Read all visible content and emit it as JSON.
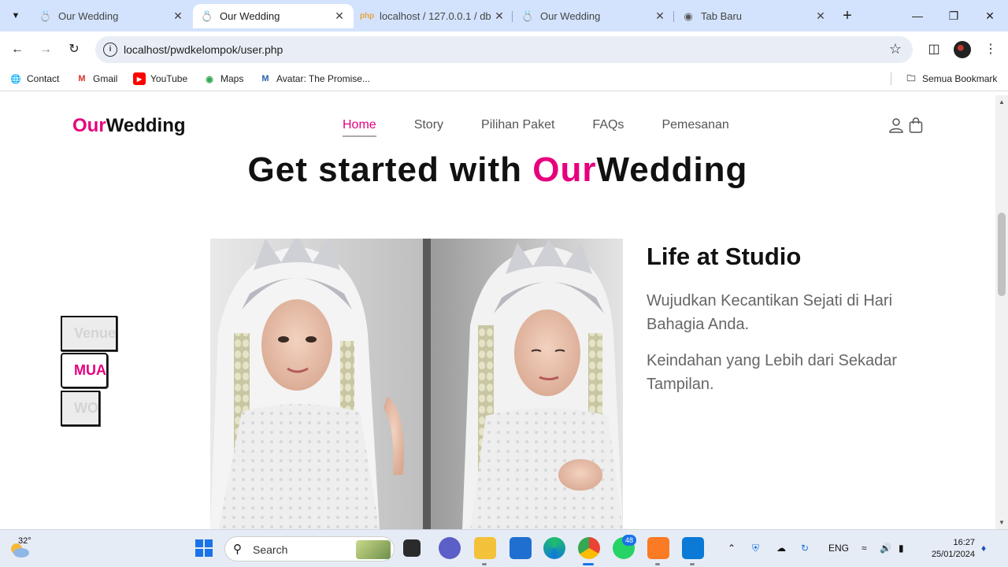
{
  "browser": {
    "tabs": [
      {
        "title": "Our Wedding",
        "active": false
      },
      {
        "title": "Our Wedding",
        "active": true
      },
      {
        "title": "localhost / 127.0.0.1 / db",
        "active": false
      },
      {
        "title": "Our Wedding",
        "active": false
      },
      {
        "title": "Tab Baru",
        "active": false
      }
    ],
    "url": "localhost/pwdkelompok/user.php",
    "bookmarks": [
      "Contact",
      "Gmail",
      "YouTube",
      "Maps",
      "Avatar: The Promise..."
    ],
    "all_bookmarks": "Semua Bookmark"
  },
  "site": {
    "logo_accent": "Our",
    "logo_rest": "Wedding",
    "nav": [
      "Home",
      "Story",
      "Pilihan Paket",
      "FAQs",
      "Pemesanan"
    ],
    "active_nav": "Home",
    "hero_prefix": "Get started with ",
    "hero_accent": "Our",
    "hero_rest": "Wedding",
    "categories": [
      "Venue",
      "MUA",
      "WO"
    ],
    "active_category": "MUA",
    "side_title": "Life at Studio",
    "side_paragraphs": [
      "Wujudkan Kecantikan Sejati di Hari Bahagia Anda.",
      "Keindahan yang Lebih dari Sekadar Tampilan."
    ]
  },
  "taskbar": {
    "temperature": "32°",
    "search_placeholder": "Search",
    "whatsapp_badge": "48",
    "language": "ENG",
    "time": "16:27",
    "date": "25/01/2024"
  },
  "colors": {
    "accent": "#e6007e",
    "tabbar": "#d3e3fd"
  }
}
